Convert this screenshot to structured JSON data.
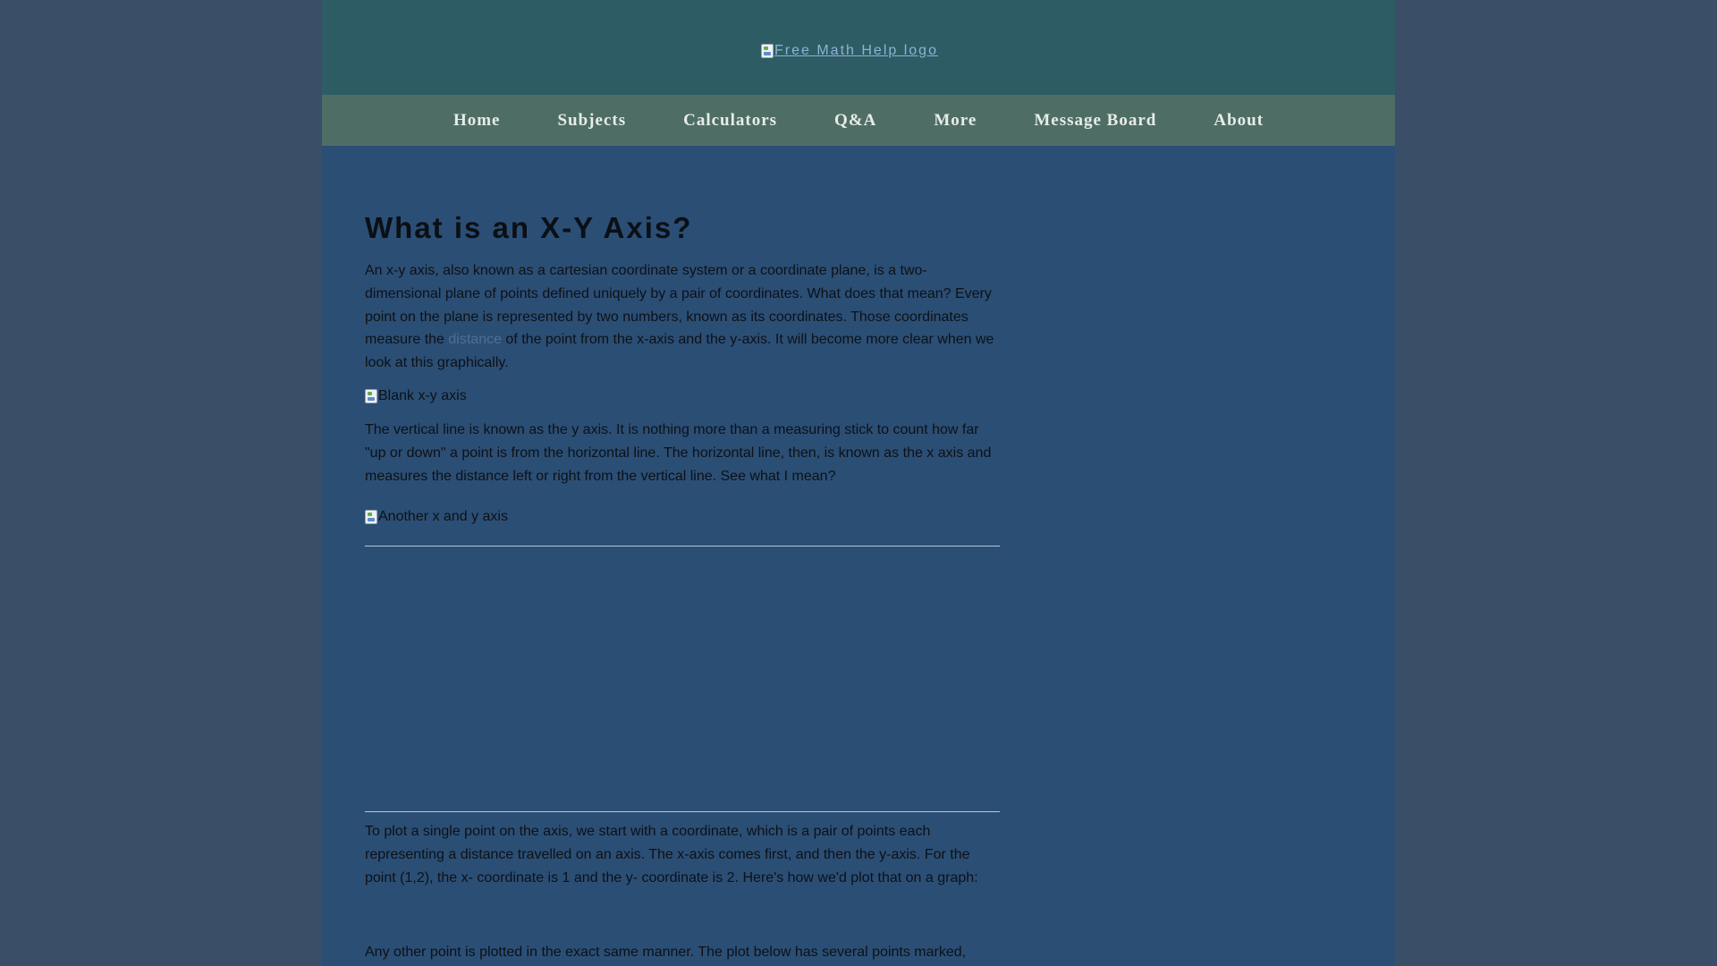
{
  "header": {
    "logo_alt": "Free Math Help logo"
  },
  "nav": {
    "items": [
      "Home",
      "Subjects",
      "Calculators",
      "Q&A",
      "More",
      "Message Board",
      "About"
    ]
  },
  "article": {
    "title": "What is an X-Y Axis?",
    "p1_before": "An x-y axis, also known as a cartesian coordinate system or a coordinate plane, is a two-dimensional plane of points defined uniquely by a pair of coordinates. What does that mean? Every point on the plane is represented by two numbers, known as its coordinates. Those coordinates measure the ",
    "p1_link": "distance",
    "p1_after": " of the point from the x-axis and the y-axis. It will become more clear when we look at this graphically.",
    "img1_alt": "Blank x-y axis",
    "p2": "The vertical line is known as the y axis. It is nothing more than a measuring stick to count how far \"up or down\" a point is from the horizontal line. The horizontal line, then, is known as the x axis and measures the distance left or right from the vertical line. See what I mean?",
    "img2_alt": "Another x and y axis",
    "p3": "To plot a single point on the axis, we start with a coordinate, which is a pair of points each representing a distance travelled on an axis. The x-axis comes first, and then the y-axis. For the point (1,2), the x- coordinate is 1 and the y- coordinate is 2. Here's how we'd plot that on a graph:",
    "p4": "Any other point is plotted in the exact same manner. The plot below has several points marked,"
  }
}
